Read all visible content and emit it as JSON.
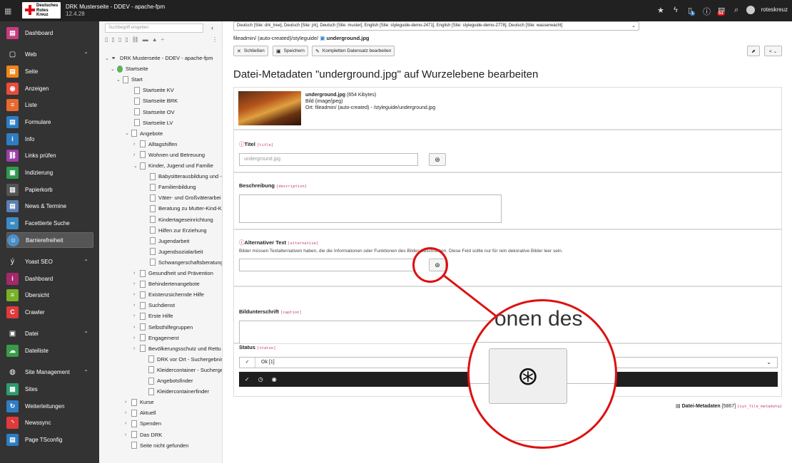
{
  "topbar": {
    "site_title": "DRK Musterseite - DDEV - apache-fpm",
    "version": "12.4.28",
    "logo_text": "Deutsches Rotes Kreuz",
    "notifications_badge": "1",
    "system_badge": "53",
    "username": "roteskreuz",
    "icons": [
      "apps-icon",
      "star-icon",
      "bolt-icon",
      "document-icon",
      "help-icon",
      "system-info-icon",
      "search-icon",
      "user-avatar-icon"
    ]
  },
  "sidebar": {
    "items": [
      {
        "label": "Dashboard",
        "color": "#c83c7e",
        "icon": "dashboard-icon"
      },
      {
        "group": "Web",
        "icon": "web-icon"
      },
      {
        "label": "Seite",
        "color": "#f18519",
        "icon": "page-icon"
      },
      {
        "label": "Anzeigen",
        "color": "#e74c3c",
        "icon": "eye-icon"
      },
      {
        "label": "Liste",
        "color": "#e8692d",
        "icon": "list-icon"
      },
      {
        "label": "Formulare",
        "color": "#2e7dc3",
        "icon": "form-icon"
      },
      {
        "label": "Info",
        "color": "#2e7dc3",
        "icon": "info-icon"
      },
      {
        "label": "Links prüfen",
        "color": "#9b3fa8",
        "icon": "link-icon"
      },
      {
        "label": "Indizierung",
        "color": "#2e9b4e",
        "icon": "index-icon"
      },
      {
        "label": "Papierkorb",
        "color": "#555555",
        "icon": "trash-icon"
      },
      {
        "label": "News & Termine",
        "color": "#5a7fb5",
        "icon": "news-icon"
      },
      {
        "label": "Facettierte Suche",
        "color": "#3b8bc6",
        "icon": "binoculars-icon"
      },
      {
        "label": "Barrierefreiheit",
        "color": "#4a90c8",
        "icon": "accessibility-icon",
        "selected": true
      },
      {
        "group": "Yoast SEO",
        "icon": "yoast-icon"
      },
      {
        "label": "Dashboard",
        "color": "#a4286a",
        "icon": "yoast-dashboard-icon"
      },
      {
        "label": "Übersicht",
        "color": "#77b227",
        "icon": "overview-icon"
      },
      {
        "label": "Crawler",
        "color": "#e03a3a",
        "icon": "crawler-icon"
      },
      {
        "group": "Datei",
        "icon": "file-icon"
      },
      {
        "label": "Dateiliste",
        "color": "#3a9b4a",
        "icon": "filelist-icon"
      },
      {
        "group": "Site Management",
        "icon": "globe-icon"
      },
      {
        "label": "Sites",
        "color": "#2e9b6e",
        "icon": "sites-icon"
      },
      {
        "label": "Weiterleitungen",
        "color": "#2e7dc3",
        "icon": "redirect-icon"
      },
      {
        "label": "Newssync",
        "color": "#e03a3a",
        "icon": "rss-icon"
      },
      {
        "label": "Page TSconfig",
        "color": "#2e7dc3",
        "icon": "tsconfig-icon"
      }
    ]
  },
  "tree": {
    "search_placeholder": "Suchbegriff eingeben",
    "nodes": [
      {
        "label": "DRK Musterseite - DDEV - apache-fpm",
        "chev": "⌄"
      },
      {
        "label": "Startseite",
        "chev": "⌄"
      },
      {
        "label": "Start",
        "chev": "⌄"
      },
      {
        "label": "Startseite KV",
        "chev": ""
      },
      {
        "label": "Startseite BRK",
        "chev": ""
      },
      {
        "label": "Startseite OV",
        "chev": ""
      },
      {
        "label": "Startseite LV",
        "chev": ""
      },
      {
        "label": "Angebote",
        "chev": "⌄"
      },
      {
        "label": "Alltagshilfen",
        "chev": "›"
      },
      {
        "label": "Wohnen und Betreuung",
        "chev": "›"
      },
      {
        "label": "Kinder, Jugend und Familie",
        "chev": "⌄"
      },
      {
        "label": "Babysitterausbildung und -",
        "chev": ""
      },
      {
        "label": "Familienbildung",
        "chev": ""
      },
      {
        "label": "Väter- und Großväterarbei",
        "chev": ""
      },
      {
        "label": "Beratung zu Mutter-Kind-K",
        "chev": ""
      },
      {
        "label": "Kindertageseinrichtung",
        "chev": ""
      },
      {
        "label": "Hilfen zur Erziehung",
        "chev": ""
      },
      {
        "label": "Jugendarbeit",
        "chev": ""
      },
      {
        "label": "Jugendsozialarbeit",
        "chev": ""
      },
      {
        "label": "Schwangerschaftsberatung",
        "chev": ""
      },
      {
        "label": "Gesundheit und Prävention",
        "chev": "›"
      },
      {
        "label": "Behindertenangebote",
        "chev": "›"
      },
      {
        "label": "Existenzsichernde Hilfe",
        "chev": "›"
      },
      {
        "label": "Suchdienst",
        "chev": "›"
      },
      {
        "label": "Erste Hilfe",
        "chev": "›"
      },
      {
        "label": "Selbsthilfegruppen",
        "chev": "›"
      },
      {
        "label": "Engagement",
        "chev": "›"
      },
      {
        "label": "Bevölkerungsschutz und Rettu",
        "chev": "›"
      },
      {
        "label": "DRK vor Ort - Suchergebnis",
        "chev": ""
      },
      {
        "label": "Kleidercontainer - Suchergebn",
        "chev": ""
      },
      {
        "label": "Angebotsfinder",
        "chev": ""
      },
      {
        "label": "Kleidercontainerfinder",
        "chev": ""
      },
      {
        "label": "Kurse",
        "chev": "›"
      },
      {
        "label": "Aktuell",
        "chev": "›"
      },
      {
        "label": "Spenden",
        "chev": "›"
      },
      {
        "label": "Das DRK",
        "chev": "›"
      },
      {
        "label": "Seite nicht gefunden",
        "chev": ""
      }
    ]
  },
  "content": {
    "language_select": "Deutsch [Site: drk_tree], Deutsch [Site: jrk], Deutsch [Site: muster], English [Site: styleguide-demo-2471], English [Site: styleguide-demo-2778], Deutsch [Site: wasserwacht]",
    "breadcrumb_path": "fileadmin/ (auto-created)/styleguide/",
    "breadcrumb_file": "underground.jpg",
    "buttons": {
      "close": "Schließen",
      "save": "Speichern",
      "edit_full": "Kompletten Datensatz bearbeiten"
    },
    "page_title": "Datei-Metadaten \"underground.jpg\" auf Wurzelebene bearbeiten",
    "file": {
      "name": "underground.jpg",
      "size": "(654 Kibytes)",
      "type": "Bild (image/jpeg)",
      "location": "Ort: fileadmin/ (auto-created) - /styleguide/underground.jpg"
    },
    "fields": {
      "title_label": "Titel",
      "title_code": "[title]",
      "title_placeholder": "underground.jpg",
      "description_label": "Beschreibung",
      "description_code": "[description]",
      "alt_label": "Alternativer Text",
      "alt_code": "[alternative]",
      "alt_hint": "Bilder müssen Textalternativen haben, die die Informationen oder Funktionen des Bildes beschreiben. Diese Feld sollte nur für rein dekorative Bilder leer sein.",
      "caption_label": "Bildunterschrift",
      "caption_code": "[caption]",
      "status_label": "Status",
      "status_code": "[status]",
      "status_value": "Ok [1]"
    },
    "footer": {
      "label": "Datei-Metadaten",
      "id": "[5867]",
      "table": "{sys_file_metadata}"
    },
    "zoom_text": "onen des"
  }
}
